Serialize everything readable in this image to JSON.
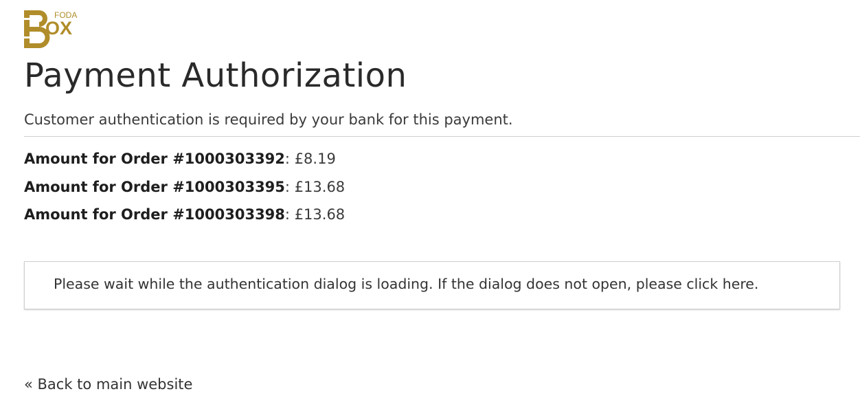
{
  "brand": {
    "logo_small": "FODA",
    "logo_big": "BOX",
    "color": "#b08d2a"
  },
  "page": {
    "title": "Payment Authorization",
    "subtitle": "Customer authentication is required by your bank for this payment."
  },
  "orders": [
    {
      "label": "Amount for Order #1000303392",
      "separator": ": ",
      "amount": "£8.19"
    },
    {
      "label": "Amount for Order #1000303395",
      "separator": ": ",
      "amount": "£13.68"
    },
    {
      "label": "Amount for Order #1000303398",
      "separator": ": ",
      "amount": "£13.68"
    }
  ],
  "notice": {
    "text_before": "Please wait while the authentication dialog is loading. If the dialog does not open, please ",
    "link": "click here",
    "text_after": "."
  },
  "footer": {
    "back_link": "« Back to main website"
  }
}
